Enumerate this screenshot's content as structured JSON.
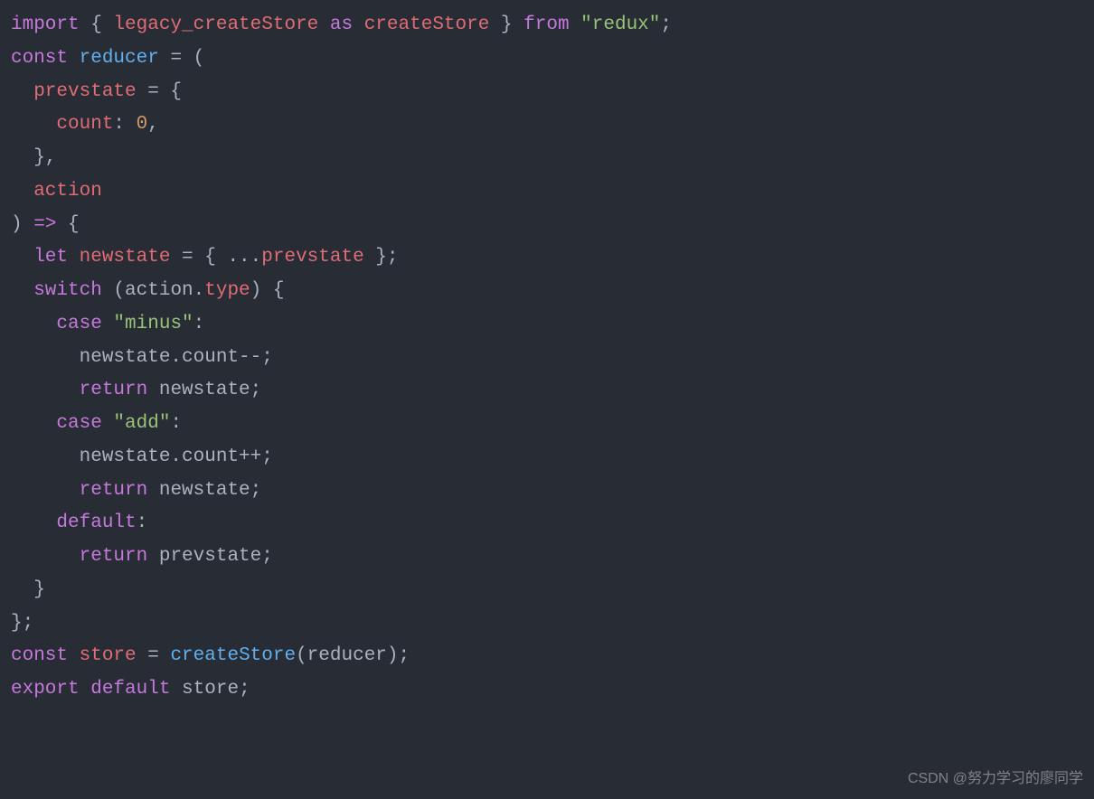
{
  "colors": {
    "background": "#282c34",
    "default": "#abb2bf",
    "keyword": "#c678dd",
    "variable": "#e06c75",
    "function": "#61afef",
    "string": "#98c379",
    "number": "#d19a66"
  },
  "tokens": {
    "import": "import",
    "lbrace1": " { ",
    "legacy_createStore": "legacy_createStore",
    "as": " as ",
    "createStore": "createStore",
    "rbrace1": " } ",
    "from": "from",
    "redux_str": " \"redux\"",
    "semi1": ";",
    "const": "const",
    "reducer": " reducer",
    "eq_paren": " = (",
    "prevstate": "  prevstate",
    "eq_brace": " = {",
    "count_key": "    count",
    "colon": ": ",
    "zero": "0",
    "comma1": ",",
    "close_brace_comma": "  },",
    "action": "  action",
    "close_paren_arrow": ") ",
    "arrow": "=>",
    "open_brace2": " {",
    "let": "  let",
    "newstate": " newstate",
    "eq_spread": " = { ...",
    "prevstate2": "prevstate",
    "close_spread": " };",
    "switch": "  switch",
    "paren_action": " (action.",
    "type": "type",
    "close_paren_brace": ") {",
    "case": "    case",
    "minus_str": " \"minus\"",
    "colon2": ":",
    "newstate_count_minus": "      newstate.count--;",
    "return": "      return",
    "newstate_semi": " newstate;",
    "add_str": " \"add\"",
    "newstate_count_plus": "      newstate.count++;",
    "default": "    default",
    "prevstate_semi": " prevstate;",
    "close_brace3": "  }",
    "close_brace_semi": "};",
    "store": " store",
    "eq2": " = ",
    "createStore_call": "createStore",
    "paren_reducer": "(reducer);",
    "export": "export",
    "default2": " default",
    "store_semi": " store;"
  },
  "watermark": "CSDN @努力学习的廖同学"
}
